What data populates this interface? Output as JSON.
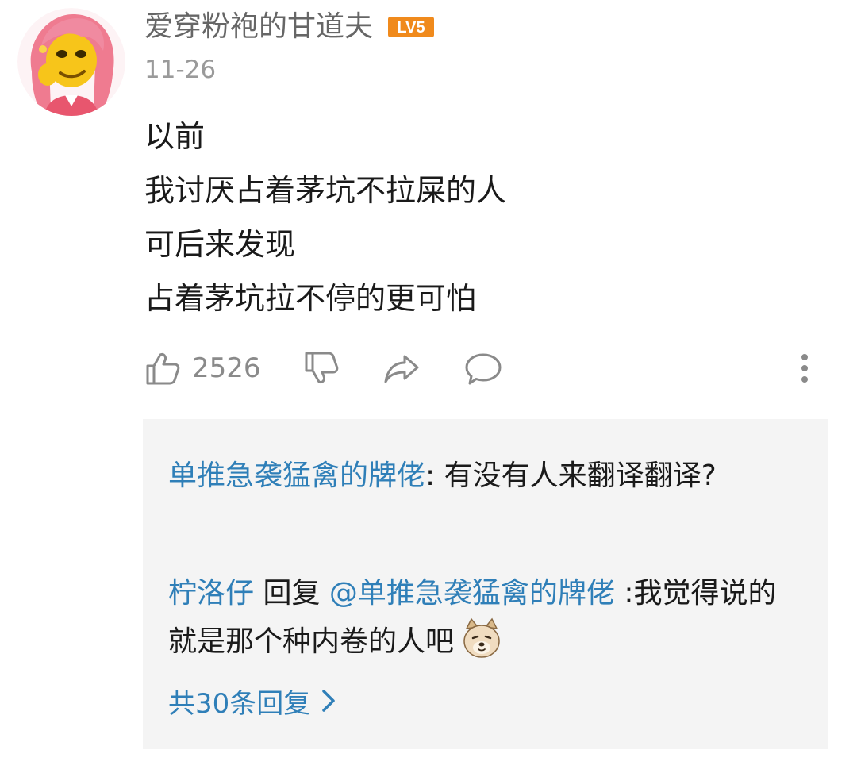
{
  "comment": {
    "username": "爱穿粉袍的甘道夫",
    "level_badge": "LV5",
    "date": "11-26",
    "lines": [
      "以前",
      "我讨厌占着茅坑不拉屎的人",
      "可后来发现",
      "占着茅坑拉不停的更可怕"
    ],
    "like_count": "2526",
    "icons": {
      "like": "thumbs-up-icon",
      "dislike": "thumbs-down-icon",
      "share": "share-icon",
      "reply": "comment-icon",
      "more": "more-vertical-icon"
    }
  },
  "replies": [
    {
      "author": "单推急袭猛禽的牌佬",
      "separator": ": ",
      "text": "有没有人来翻译翻译?"
    },
    {
      "author": "柠洛仔",
      "verb": " 回复 ",
      "target": "@单推急袭猛禽的牌佬",
      "separator": " :",
      "text": "我觉得说的就是那个种内卷的人吧",
      "emoji": "doge-emoji"
    }
  ],
  "more_replies_label": "共30条回复",
  "colors": {
    "link": "#2f7fb8",
    "text": "#1a1a1a",
    "meta": "#9a9a9a",
    "badge": "#f08a1c",
    "reply_bg": "#f4f4f4"
  }
}
